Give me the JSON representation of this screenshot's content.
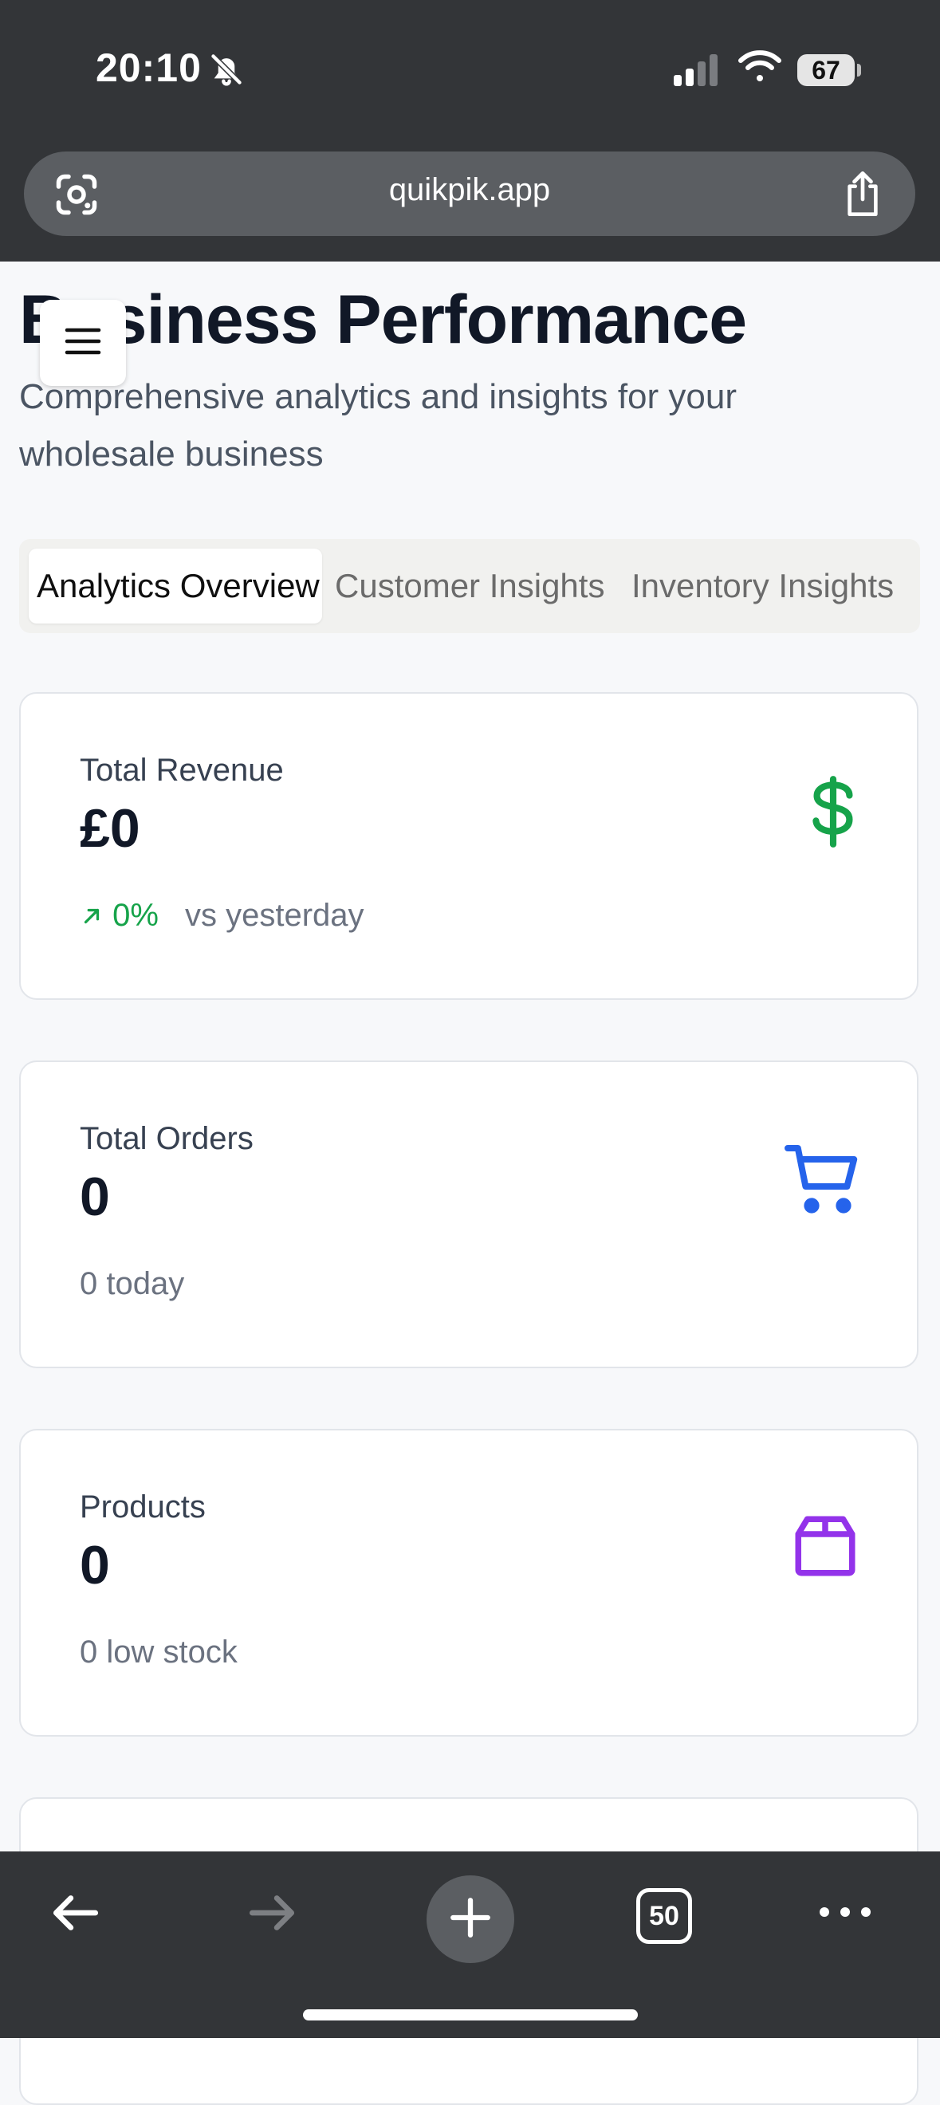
{
  "status_bar": {
    "time": "20:10",
    "battery": "67"
  },
  "browser": {
    "url": "quikpik.app",
    "tab_count": "50"
  },
  "page": {
    "title": "Business Performance",
    "subtitle": "Comprehensive analytics and insights for your wholesale business",
    "tabs": [
      {
        "label": "Analytics Overview",
        "active": true
      },
      {
        "label": "Customer Insights",
        "active": false
      },
      {
        "label": "Inventory Insights",
        "active": false
      }
    ]
  },
  "cards": {
    "revenue": {
      "label": "Total Revenue",
      "value": "£0",
      "trend": "0%",
      "trend_label": "vs yesterday",
      "icon": "dollar-icon",
      "color": "#16a34a"
    },
    "orders": {
      "label": "Total Orders",
      "value": "0",
      "sub": "0 today",
      "icon": "cart-icon",
      "color": "#2563eb"
    },
    "products": {
      "label": "Products",
      "value": "0",
      "sub": "0 low stock",
      "icon": "package-icon",
      "color": "#9333ea"
    }
  }
}
